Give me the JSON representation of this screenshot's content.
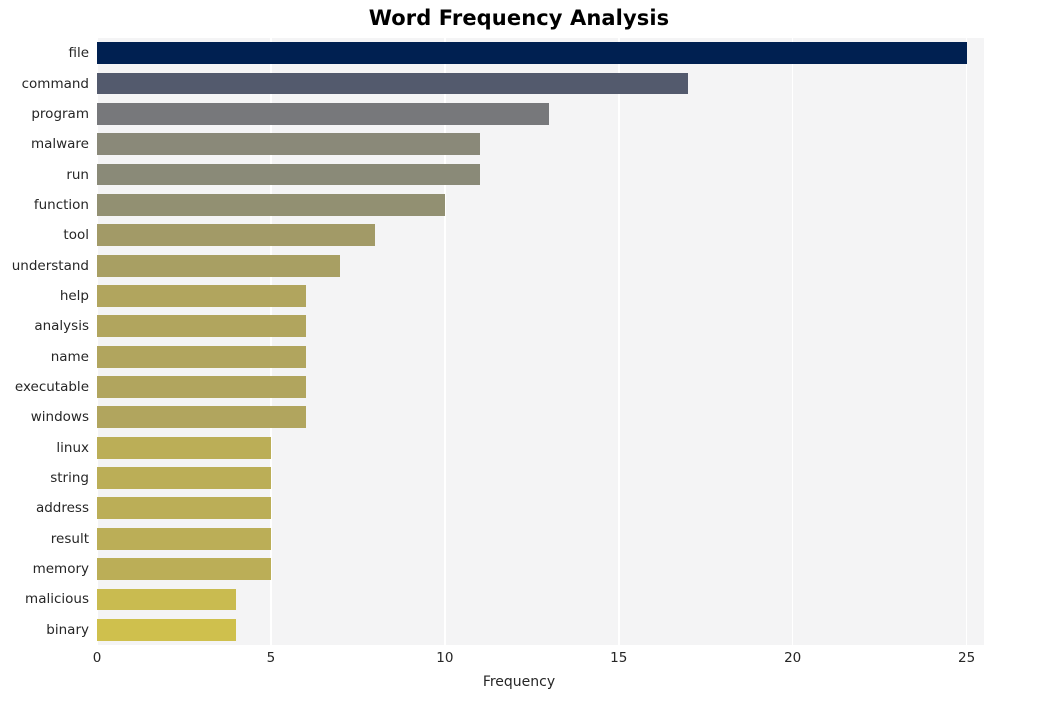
{
  "chart_data": {
    "type": "bar",
    "orientation": "horizontal",
    "title": "Word Frequency Analysis",
    "xlabel": "Frequency",
    "ylabel": "",
    "categories": [
      "file",
      "command",
      "program",
      "malware",
      "run",
      "function",
      "tool",
      "understand",
      "help",
      "analysis",
      "name",
      "executable",
      "windows",
      "linux",
      "string",
      "address",
      "result",
      "memory",
      "malicious",
      "binary"
    ],
    "values": [
      25,
      17,
      13,
      11,
      11,
      10,
      8,
      7,
      6,
      6,
      6,
      6,
      6,
      5,
      5,
      5,
      5,
      5,
      4,
      4
    ],
    "bar_colors": [
      "#002051",
      "#535a6d",
      "#77787b",
      "#8a8979",
      "#8a8a78",
      "#929072",
      "#a29a67",
      "#a89f63",
      "#b1a55e",
      "#b1a55e",
      "#b1a55e",
      "#b1a55e",
      "#b1a55e",
      "#bbae57",
      "#bbae57",
      "#bbae57",
      "#bbae57",
      "#bbae57",
      "#c9bb50",
      "#cfc04d"
    ],
    "xlim": [
      0,
      25.5
    ],
    "xticks": [
      0,
      5,
      10,
      15,
      20,
      25
    ],
    "xtick_labels": [
      "0",
      "5",
      "10",
      "15",
      "20",
      "25"
    ],
    "grid": true,
    "grid_axis": "x",
    "grid_color": "#ffffff",
    "plot_background": "#f4f4f5",
    "figure_background": "#ffffff",
    "legend": null,
    "colormap": "cividis"
  }
}
